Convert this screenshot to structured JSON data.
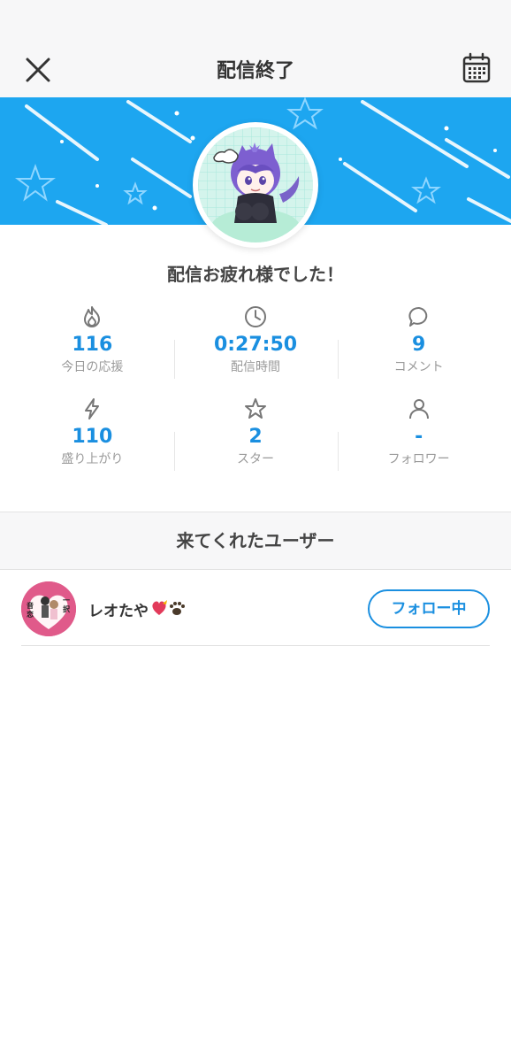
{
  "header": {
    "title": "配信終了",
    "close_icon": "close-icon",
    "calendar_icon": "calendar-icon"
  },
  "banner": {
    "color": "#1da6f0"
  },
  "message": "配信お疲れ様でした！",
  "stats": [
    {
      "icon": "fire-icon",
      "value": "116",
      "label": "今日の応援"
    },
    {
      "icon": "clock-icon",
      "value": "0:27:50",
      "label": "配信時間"
    },
    {
      "icon": "comment-icon",
      "value": "9",
      "label": "コメント"
    },
    {
      "icon": "lightning-icon",
      "value": "110",
      "label": "盛り上がり"
    },
    {
      "icon": "star-icon",
      "value": "2",
      "label": "スター"
    },
    {
      "icon": "person-icon",
      "value": "-",
      "label": "フォロワー"
    }
  ],
  "visitors": {
    "section_title": "来てくれたユーザー",
    "users": [
      {
        "name": "レオたや",
        "button_label": "フォロー中",
        "avatar_text": [
          "音",
          "恋",
          "一",
          "択"
        ]
      }
    ]
  },
  "colors": {
    "accent": "#1a8fe0",
    "label_gray": "#9a9a9a"
  }
}
